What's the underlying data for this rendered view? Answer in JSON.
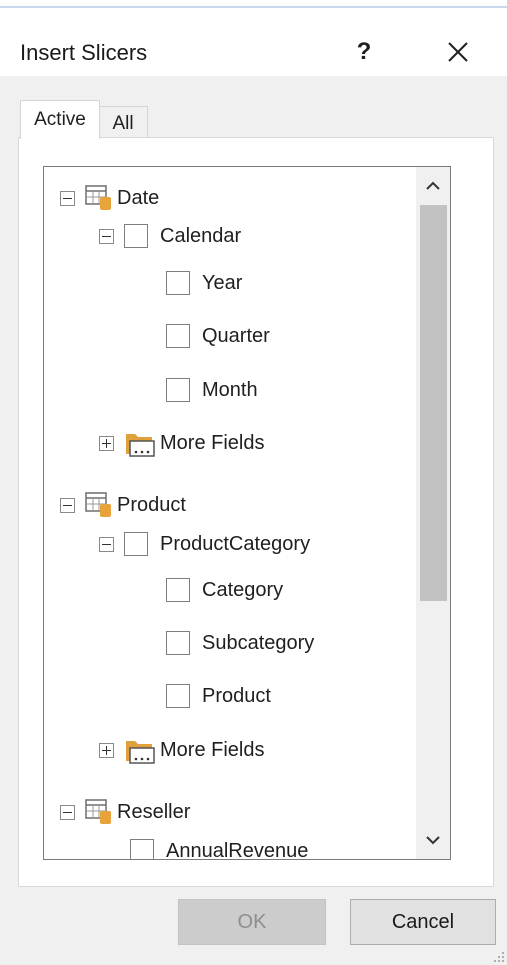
{
  "dialog": {
    "title": "Insert Slicers",
    "help_label": "?",
    "close_icon": "close-icon"
  },
  "tabs": [
    {
      "label": "Active",
      "selected": true
    },
    {
      "label": "All",
      "selected": false
    }
  ],
  "tree": {
    "date": {
      "label": "Date",
      "expanded": true,
      "calendar": {
        "label": "Calendar",
        "checked": false,
        "expanded": true
      },
      "fields": [
        {
          "label": "Year",
          "checked": false
        },
        {
          "label": "Quarter",
          "checked": false
        },
        {
          "label": "Month",
          "checked": false
        }
      ],
      "more_fields": "More Fields"
    },
    "product": {
      "label": "Product",
      "expanded": true,
      "category_group": {
        "label": "ProductCategory",
        "checked": false,
        "expanded": true
      },
      "fields": [
        {
          "label": "Category",
          "checked": false
        },
        {
          "label": "Subcategory",
          "checked": false
        },
        {
          "label": "Product",
          "checked": false
        }
      ],
      "more_fields": "More Fields"
    },
    "reseller": {
      "label": "Reseller",
      "expanded": true,
      "fields": [
        {
          "label": "AnnualRevenue",
          "checked": false
        }
      ]
    }
  },
  "buttons": {
    "ok": "OK",
    "ok_enabled": false,
    "cancel": "Cancel"
  },
  "colors": {
    "accent_line": "#c9d8ec",
    "scroll_thumb": "#c2c2c2",
    "table_icon_body": "#e8a33a",
    "folder_icon": "#e0a13c"
  }
}
